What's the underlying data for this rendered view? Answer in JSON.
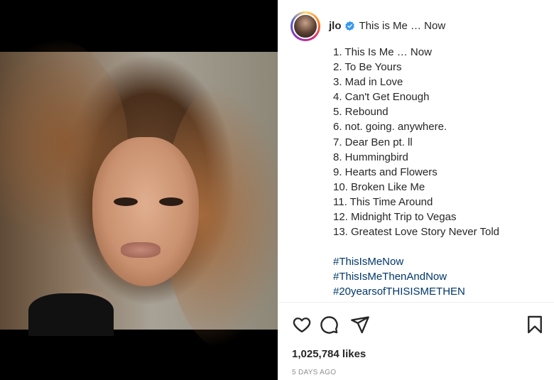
{
  "post": {
    "username": "jlo",
    "verified": true,
    "title": "This is Me … Now",
    "tracklist": [
      "1. This Is Me … Now",
      "2. To Be Yours",
      "3. Mad in Love",
      "4. Can't Get Enough",
      "5. Rebound",
      "6. not. going. anywhere.",
      "7. Dear Ben pt. ll",
      "8. Hummingbird",
      "9. Hearts and Flowers",
      "10. Broken Like Me",
      "11. This Time Around",
      "12. Midnight Trip to Vegas",
      "13. Greatest Love Story Never Told"
    ],
    "hashtags": [
      "#ThisIsMeNow",
      "#ThisIsMeThenAndNow",
      "#20yearsofTHISISMETHEN"
    ],
    "likes": "1,025,784 likes",
    "date": "5 DAYS AGO"
  },
  "icons": {
    "like": "heart-icon",
    "comment": "comment-icon",
    "share": "share-icon",
    "save": "bookmark-icon",
    "verified": "verified-badge-icon"
  },
  "colors": {
    "verified": "#3897f0",
    "hashtag": "#00376b",
    "text": "#262626",
    "muted": "#8e8e8e"
  }
}
